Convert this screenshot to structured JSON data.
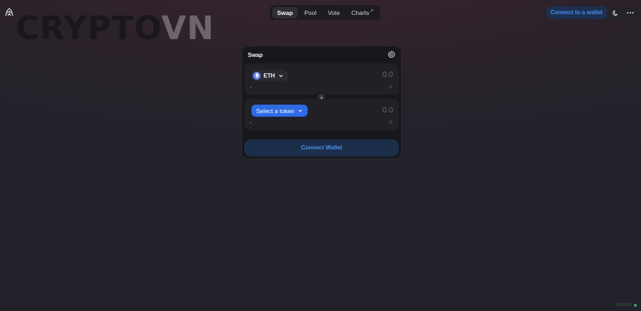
{
  "brand": {
    "watermark_dark": "CRYPTO",
    "watermark_light": "VN"
  },
  "nav": {
    "items": [
      {
        "label": "Swap",
        "active": true
      },
      {
        "label": "Pool"
      },
      {
        "label": "Vote"
      },
      {
        "label": "Charts",
        "external_glyph": "↗"
      }
    ]
  },
  "header": {
    "connect_label": "Connect to a wallet"
  },
  "swap": {
    "title": "Swap",
    "input": {
      "token": "ETH",
      "amount": "0.0",
      "balance": "-",
      "usd": "$-"
    },
    "output": {
      "select_label": "Select a token",
      "amount": "0.0",
      "balance": "-",
      "usd": "$-"
    },
    "connect_wallet_label": "Connect Wallet"
  },
  "status": {
    "text": "13501920"
  },
  "colors": {
    "accent": "#2e6be4",
    "connect_bg": "#1c3152",
    "connect_text": "#4c8cf0",
    "eth": "#627eea",
    "status_dot": "#27ae60"
  }
}
